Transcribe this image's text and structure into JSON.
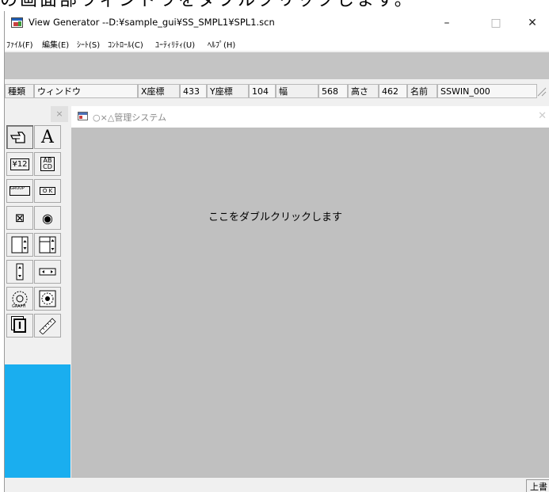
{
  "caption": "の画面部ウィンドウをダブルクリックします。",
  "window": {
    "title": "View Generator --D:¥sample_gui¥SS_SMPL1¥SPL1.scn",
    "minimize": "–",
    "maximize": "□",
    "close": "✕"
  },
  "menu": [
    {
      "label": "ﾌｧｲﾙ(F)"
    },
    {
      "label": "編集(E)"
    },
    {
      "label": "ｼｰﾄ(S)"
    },
    {
      "label": "ｺﾝﾄﾛｰﾙ(C)"
    },
    {
      "label": "ﾕｰﾃｨﾘﾃｨ(U)"
    },
    {
      "label": "ﾍﾙﾌﾟ(H)"
    }
  ],
  "props": {
    "kind_label": "種類",
    "kind_value": "ウィンドウ",
    "x_label": "X座標",
    "x_value": "433",
    "y_label": "Y座標",
    "y_value": "104",
    "w_label": "幅",
    "w_value": "568",
    "h_label": "高さ",
    "h_value": "462",
    "name_label": "名前",
    "name_value": "SSWIN_000"
  },
  "palette": {
    "close": "×",
    "tools": [
      {
        "name": "pointer-tool-icon",
        "text": ""
      },
      {
        "name": "text-tool-icon",
        "text": "A"
      },
      {
        "name": "numeric-field-tool-icon",
        "text": "¥12"
      },
      {
        "name": "text-field-tool-icon",
        "text": "AB CD"
      },
      {
        "name": "group-box-tool-icon",
        "text": "GROUP"
      },
      {
        "name": "button-tool-icon",
        "text": "O K"
      },
      {
        "name": "checkbox-tool-icon",
        "text": "⊠"
      },
      {
        "name": "radio-tool-icon",
        "text": "◉"
      },
      {
        "name": "vscroll-list-tool-icon",
        "text": ""
      },
      {
        "name": "vscroll-list2-tool-icon",
        "text": ""
      },
      {
        "name": "vscrollbar-tool-icon",
        "text": ""
      },
      {
        "name": "hscrollbar-tool-icon",
        "text": ""
      },
      {
        "name": "image-tool-icon",
        "text": ""
      },
      {
        "name": "image2-tool-icon",
        "text": ""
      },
      {
        "name": "ime-tool-icon",
        "text": "I"
      },
      {
        "name": "ruler-tool-icon",
        "text": ""
      }
    ]
  },
  "child_window": {
    "title": "○×△管理システム",
    "close": "✕",
    "body_text": "ここをダブルクリックします"
  },
  "status": {
    "right": "上書"
  }
}
